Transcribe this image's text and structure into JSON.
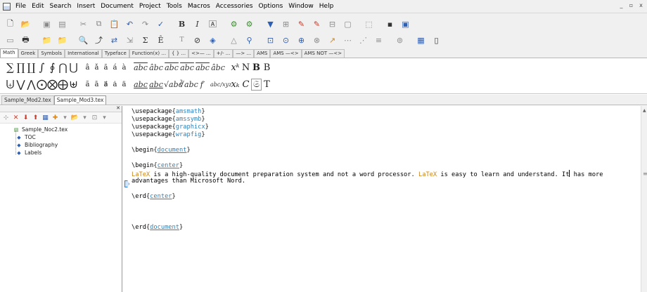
{
  "menu": {
    "items": [
      "File",
      "Edit",
      "Search",
      "Insert",
      "Document",
      "Project",
      "Tools",
      "Macros",
      "Accessories",
      "Options",
      "Window",
      "Help"
    ]
  },
  "window_controls": [
    "_",
    "▫",
    "x"
  ],
  "symbol_tabs": {
    "items": [
      "Math",
      "Greek",
      "Symbols",
      "International",
      "Typeface",
      "Function(x)  ...",
      "{ }  ...",
      "<>—  ...",
      "+/-  ...",
      "—>  ...",
      "AMS",
      "AMS —<>",
      "AMS NOT —<>"
    ]
  },
  "doc_tabs": {
    "items": [
      "Sample_Mod2.tex",
      "Sample_Mod3.tex"
    ],
    "active": 1
  },
  "tree": {
    "root": "Sample_Noc2.tex",
    "children": [
      "TOC",
      "Bibliography",
      "Labels"
    ]
  },
  "editor": {
    "line1_cmd": "\\usepackage",
    "line1_arg": "amsmath",
    "line2_cmd": "\\usepackage",
    "line2_arg": "amssymb",
    "line3_cmd": "\\usepackage",
    "line3_arg": "graphicx",
    "line4_cmd": "\\usepackage",
    "line4_arg": "wrapfig",
    "begin_doc_cmd": "\\begin",
    "begin_doc_arg": "document",
    "begin_center_cmd": "\\begin",
    "begin_center_arg": "center",
    "para1_latex": "LaTeX",
    "para1_mid": " is a high-quality document preparation system and not a word processor. ",
    "para1_latex2": "LaTeX",
    "para1_end_a": " is easy to learn and understand. It",
    "para1_end_b": " has more",
    "para2": "advantages than Microsoft Nord.",
    "end_center_cmd": "\\erd",
    "end_center_arg": "center",
    "end_doc_cmd": "\\erd",
    "end_doc_arg": "document"
  }
}
